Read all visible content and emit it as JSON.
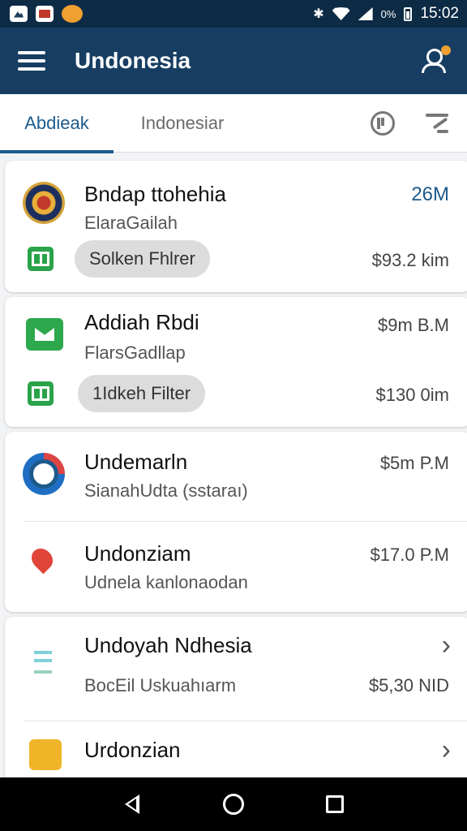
{
  "status_bar": {
    "time": "15:02",
    "battery_text": "0%",
    "icons": [
      "gallery-icon",
      "image-icon",
      "notification-app-icon",
      "bluetooth-icon",
      "wifi-icon",
      "signal-icon",
      "battery-icon"
    ],
    "bluetooth_glyph": "✱"
  },
  "app_bar": {
    "title": "Undonesia",
    "icons": [
      "menu-icon",
      "account-icon"
    ]
  },
  "tabs": [
    {
      "label": "Abdieak",
      "active": true
    },
    {
      "label": "Indonesiar",
      "active": false
    }
  ],
  "tab_actions": [
    "history-icon",
    "sort-icon"
  ],
  "cards": [
    {
      "title": "Bndap ttohehia",
      "subtitle": "ElaraGailah",
      "amount": "26M",
      "amount_color": "#1c5a8c",
      "pill": "Solken Fhlrer",
      "pill_amount": "$93.2 kim",
      "icon": "emblem-icon"
    },
    {
      "title": "Addiah Rbdi",
      "subtitle": "FlarsGadllap",
      "amount": "$9m B.M",
      "pill": "1Idkeh Filter",
      "pill_amount": "$130 0im",
      "icon": "mail-icon"
    },
    {
      "rows": [
        {
          "title": "Undemarln",
          "subtitle": "SianahUdta (sstaraı)",
          "amount": "$5m P.M",
          "icon": "ring-icon"
        },
        {
          "title": "Undonziam",
          "subtitle": "Udnela kanlonaodan",
          "amount": "$17.0 P.M",
          "icon": "map-icon"
        }
      ]
    },
    {
      "rows": [
        {
          "title": "Undoyah Ndhesia",
          "subtitle": "BocEil Uskuahıarm",
          "amount": "$5,30 NID",
          "chevron": "›",
          "icon": "doc-icon"
        },
        {
          "title": "Urdonzian",
          "subtitle": "",
          "amount": "",
          "chevron": "›",
          "icon": "wallet-icon"
        }
      ]
    }
  ],
  "nav_bar": [
    "back-icon",
    "home-icon",
    "recents-icon"
  ]
}
